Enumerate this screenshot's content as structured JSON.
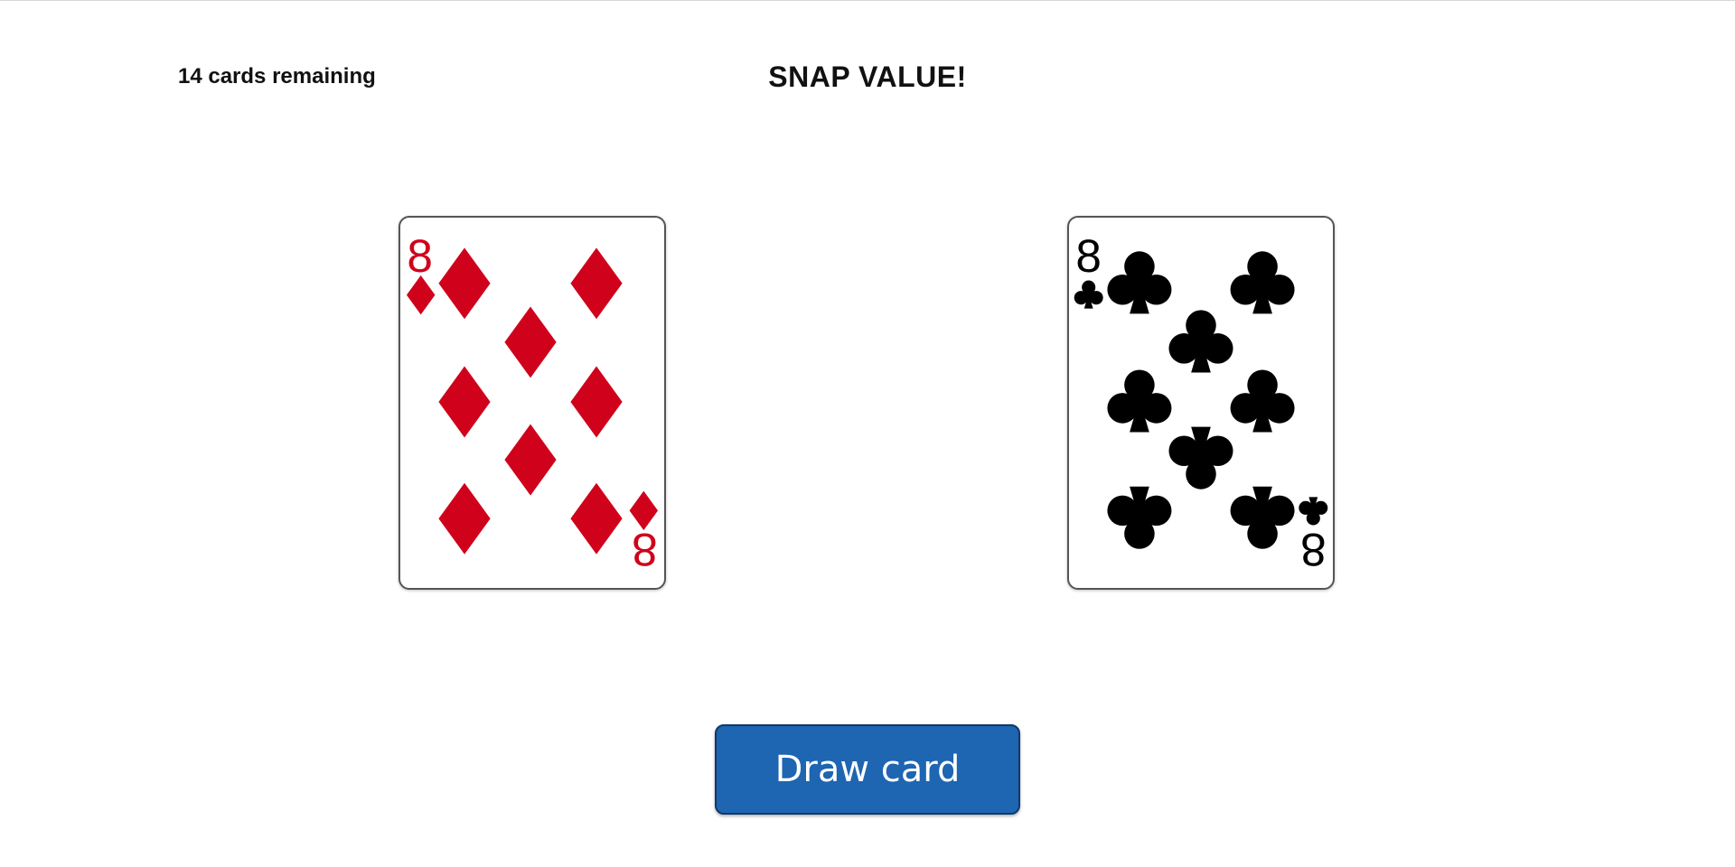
{
  "status": {
    "count": 14,
    "text": "14 cards remaining"
  },
  "title": "SNAP VALUE!",
  "cards": [
    {
      "rank": "8",
      "suit": "diamonds",
      "color": "#d0021b",
      "icon": "diamond-suit-icon"
    },
    {
      "rank": "8",
      "suit": "clubs",
      "color": "#000000",
      "icon": "club-suit-icon"
    }
  ],
  "draw_button": {
    "label": "Draw card",
    "color": "#1e65b2"
  }
}
